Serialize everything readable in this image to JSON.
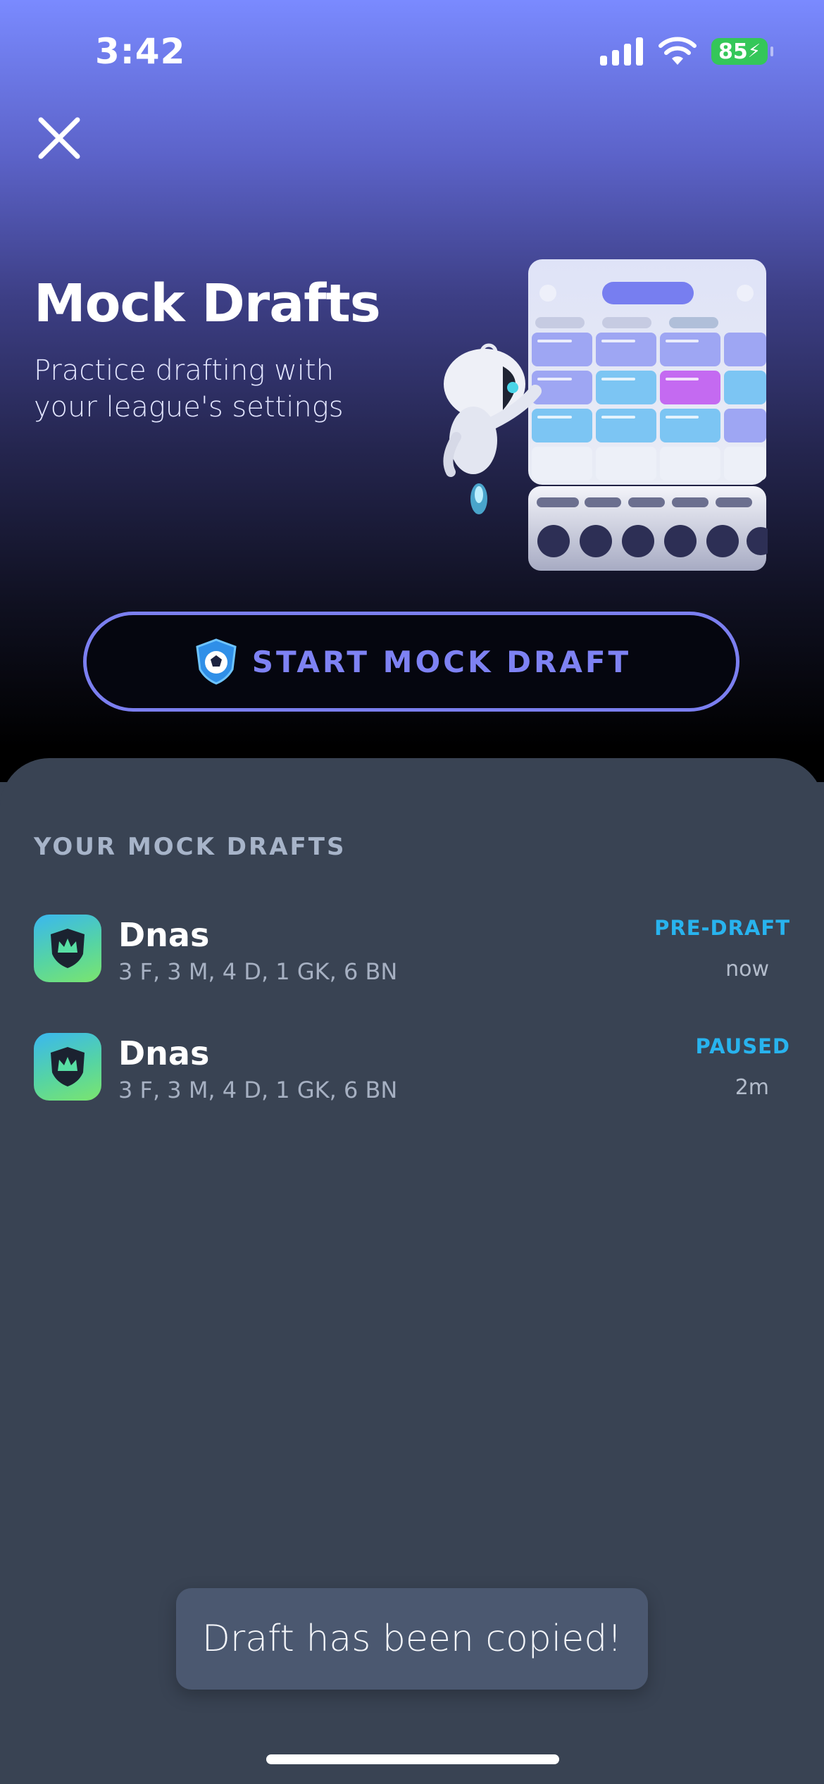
{
  "status_bar": {
    "time": "3:42",
    "battery": "85",
    "icons": [
      "cellular-signal-icon",
      "wifi-icon",
      "battery-charging-icon"
    ]
  },
  "hero": {
    "title": "Mock Drafts",
    "subtitle": "Practice drafting with your league's settings",
    "start_button_label": "START MOCK DRAFT"
  },
  "mock_drafts": {
    "section_title": "YOUR MOCK DRAFTS",
    "items": [
      {
        "name": "Dnas",
        "roster": "3 F, 3 M, 4 D, 1 GK, 6 BN",
        "status": "PRE-DRAFT",
        "time": "now"
      },
      {
        "name": "Dnas",
        "roster": "3 F, 3 M, 4 D, 1 GK, 6 BN",
        "status": "PAUSED",
        "time": "2m"
      }
    ]
  },
  "toast": {
    "message": "Draft has been copied!"
  },
  "colors": {
    "accent": "#7B7FF0",
    "status_blue": "#28B3EE",
    "sheet_bg": "#394353",
    "battery_green": "#34C759"
  }
}
